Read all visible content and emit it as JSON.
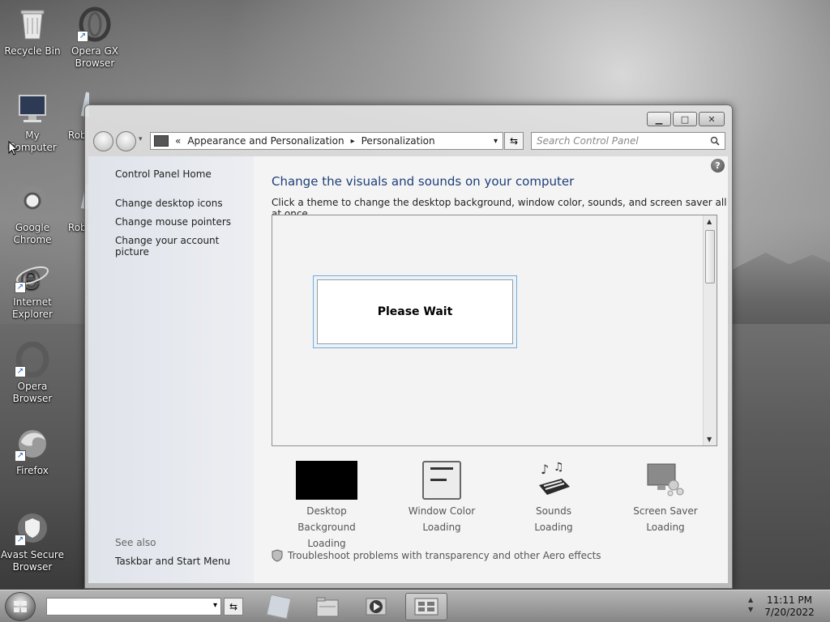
{
  "desktop": {
    "icons": [
      {
        "label": "Recycle Bin",
        "icon": "recycle-bin-icon"
      },
      {
        "label": "Opera GX Browser",
        "icon": "opera-gx-icon"
      },
      {
        "label": "My Computer",
        "icon": "computer-icon"
      },
      {
        "label": "Robl",
        "icon": "roblox-icon"
      },
      {
        "label": "Google Chrome",
        "icon": "chrome-icon"
      },
      {
        "label": "Robl",
        "icon": "roblox-icon"
      },
      {
        "label": "Internet Explorer",
        "icon": "ie-icon"
      },
      {
        "label": "Opera Browser",
        "icon": "opera-icon"
      },
      {
        "label": "Firefox",
        "icon": "firefox-icon"
      },
      {
        "label": "Avast Secure Browser",
        "icon": "avast-icon"
      }
    ]
  },
  "window": {
    "caption_buttons": {
      "minimize": "▁",
      "maximize": "□",
      "close": "✕"
    },
    "address": {
      "prefix": "«",
      "crumbs": [
        "Appearance and Personalization",
        "Personalization"
      ],
      "separator": "▸",
      "dropdown": "▾"
    },
    "refresh_glyph": "⇆",
    "search_placeholder": "Search Control Panel",
    "help_glyph": "?",
    "leftpane": {
      "home": "Control Panel Home",
      "links": [
        "Change desktop icons",
        "Change mouse pointers",
        "Change your account picture"
      ],
      "see_also_label": "See also",
      "see_also": [
        "Taskbar and Start Menu"
      ]
    },
    "main": {
      "heading": "Change the visuals and sounds on your computer",
      "subheading": "Click a theme to change the desktop background, window color, sounds, and screen saver all at once.",
      "dialog_text": "Please Wait",
      "items": [
        {
          "label": "Desktop Background",
          "status": "Loading",
          "icon": "desktop-background-icon"
        },
        {
          "label": "Window Color",
          "status": "Loading",
          "icon": "window-color-icon"
        },
        {
          "label": "Sounds",
          "status": "Loading",
          "icon": "sounds-icon"
        },
        {
          "label": "Screen Saver",
          "status": "Loading",
          "icon": "screen-saver-icon"
        }
      ],
      "troubleshoot": "Troubleshoot problems with transparency and other Aero effects"
    }
  },
  "taskbar": {
    "clock_time": "11:11 PM",
    "clock_date": "7/20/2022",
    "refresh_glyph": "⇆",
    "dropdown": "▾"
  },
  "colors": {
    "heading": "#1e3e7a",
    "dialog_border": "#79a8d8"
  }
}
